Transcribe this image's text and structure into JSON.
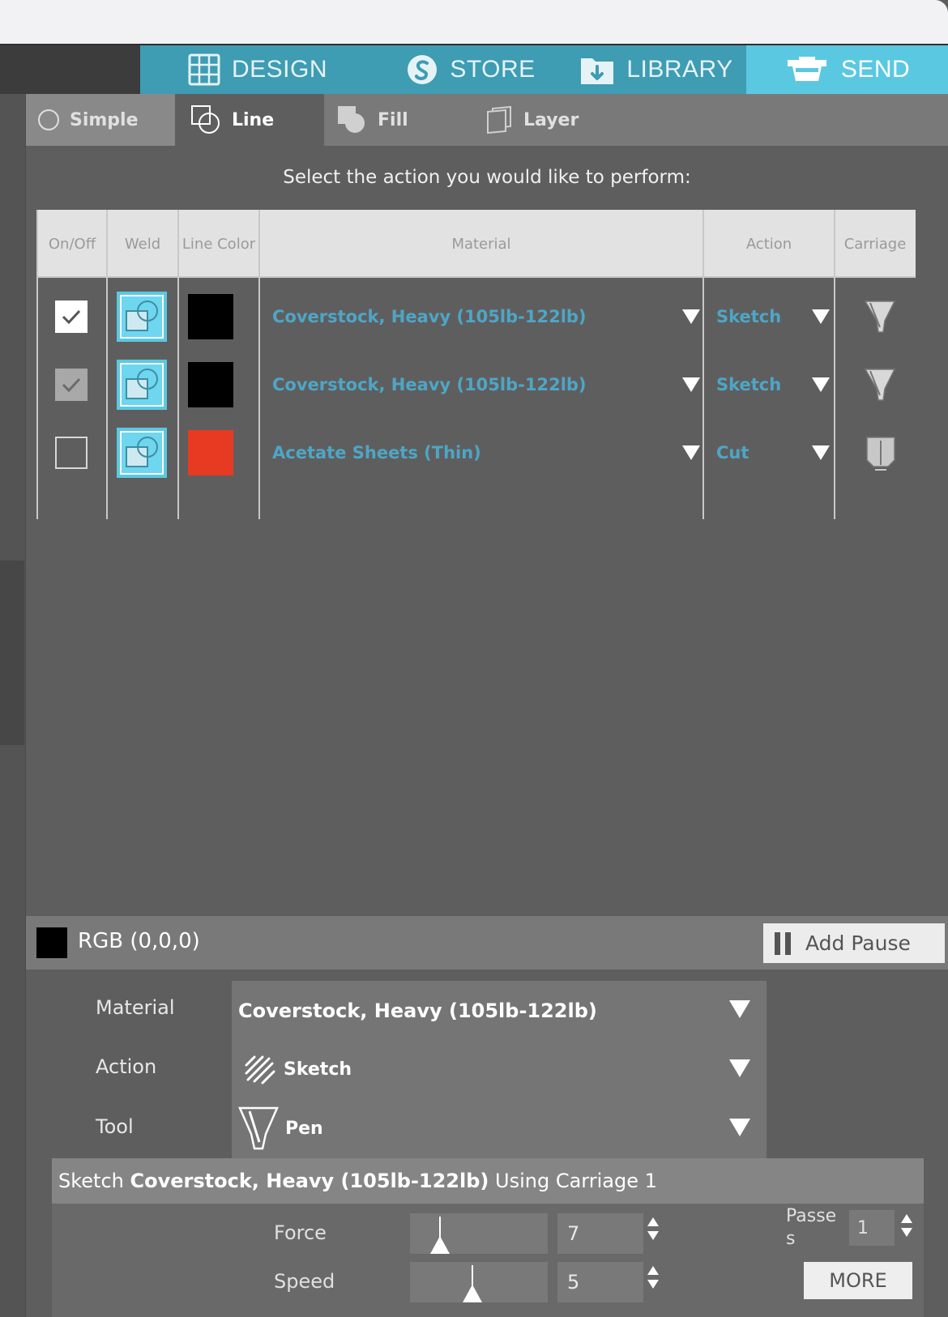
{
  "nav": {
    "tabs": [
      {
        "label": "DESIGN",
        "icon": "grid-icon"
      },
      {
        "label": "STORE",
        "icon": "store-s-icon"
      },
      {
        "label": "LIBRARY",
        "icon": "library-download-icon"
      },
      {
        "label": "SEND",
        "icon": "cutter-machine-icon",
        "active": true
      }
    ]
  },
  "subtabs": [
    {
      "label": "Simple"
    },
    {
      "label": "Line",
      "active": true
    },
    {
      "label": "Fill"
    },
    {
      "label": "Layer"
    }
  ],
  "instruction": "Select the action you would like to perform:",
  "table": {
    "headers": [
      "On/Off",
      "Weld",
      "Line Color",
      "Material",
      "Action",
      "Carriage"
    ],
    "rows": [
      {
        "state": "checked",
        "color": "#000000",
        "material": "Coverstock, Heavy (105lb-122lb)",
        "action": "Sketch",
        "carriage": "pen-tool-icon"
      },
      {
        "state": "checked-disabled",
        "color": "#000000",
        "material": "Coverstock, Heavy (105lb-122lb)",
        "action": "Sketch",
        "carriage": "pen-tool-icon"
      },
      {
        "state": "unchecked",
        "color": "#e83a22",
        "material": "Acetate Sheets (Thin)",
        "action": "Cut",
        "carriage": "blade-tool-icon"
      }
    ]
  },
  "colorbar": {
    "label": "RGB (0,0,0)",
    "swatch": "#000000",
    "pause_label": "Add Pause"
  },
  "settings": {
    "material_label": "Material",
    "material_value": "Coverstock, Heavy (105lb-122lb)",
    "action_label": "Action",
    "action_value": "Sketch",
    "tool_label": "Tool",
    "tool_value": "Pen"
  },
  "sketch": {
    "head_prefix": "Sketch ",
    "head_material": "Coverstock, Heavy (105lb-122lb)",
    "head_suffix": " Using Carriage 1",
    "force_label": "Force",
    "force_value": "7",
    "speed_label": "Speed",
    "speed_value": "5",
    "passes_label": "Passe s",
    "passes_value": "1",
    "more_label": "MORE"
  },
  "colors": {
    "accent": "#5bc8e1",
    "nav_bg": "#3e9cb3",
    "material_text": "#4da6c6",
    "red_line": "#e83a22"
  }
}
